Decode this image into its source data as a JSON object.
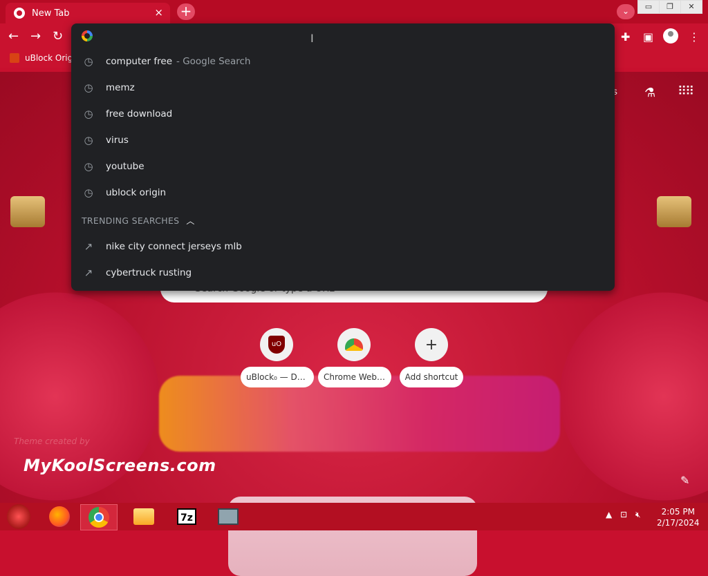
{
  "browser": {
    "tab_title": "New Tab",
    "tab_close": "×",
    "new_tab": "+",
    "window_buttons": [
      "▭",
      "❐",
      "✕"
    ],
    "bookmark": "uBlock Origin"
  },
  "omnibox": {
    "input_value": "",
    "suggestions": [
      {
        "text": "computer free",
        "hint": "- Google Search"
      },
      {
        "text": "memz",
        "hint": ""
      },
      {
        "text": "free download",
        "hint": ""
      },
      {
        "text": "virus",
        "hint": ""
      },
      {
        "text": "youtube",
        "hint": ""
      },
      {
        "text": "ublock origin",
        "hint": ""
      }
    ],
    "trending_header": "TRENDING SEARCHES",
    "trending": [
      {
        "text": "nike city connect jerseys mlb"
      },
      {
        "text": "cybertruck rusting"
      }
    ]
  },
  "ntp": {
    "images_link": "ges",
    "search_placeholder": "Search Google or type a URL",
    "shortcuts": [
      {
        "label": "uBlock₀ — Da..."
      },
      {
        "label": "Chrome Web ..."
      },
      {
        "label": "Add shortcut"
      }
    ],
    "theme_credit": "Theme created by",
    "theme_site": "MyKoolScreens.com"
  },
  "taskbar": {
    "time": "2:05 PM",
    "date": "2/17/2024"
  }
}
